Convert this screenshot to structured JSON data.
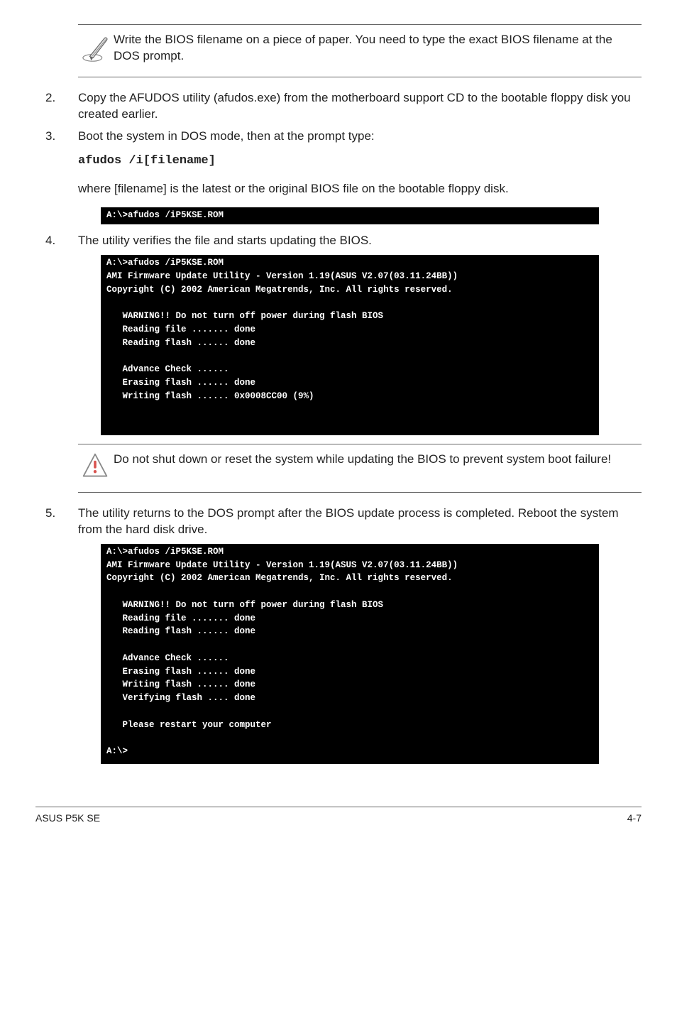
{
  "note1": "Write the BIOS filename on a piece of paper. You need to type the exact BIOS filename at the DOS prompt.",
  "steps": {
    "s2": {
      "num": "2.",
      "text": "Copy the AFUDOS utility (afudos.exe) from the motherboard support CD to the bootable floppy disk you created earlier."
    },
    "s3": {
      "num": "3.",
      "text": "Boot the system in DOS mode, then at the prompt type:",
      "cmd": "afudos /i[filename]"
    },
    "s3_after": "where [filename] is the latest or the original BIOS file on the bootable floppy disk.",
    "s4": {
      "num": "4.",
      "text": "The utility verifies the file and starts updating the BIOS."
    },
    "s5": {
      "num": "5.",
      "text": "The utility returns to the DOS prompt after the BIOS update process is completed. Reboot the system from the hard disk drive."
    }
  },
  "console1": "A:\\>afudos /iP5KSE.ROM",
  "console2": "A:\\>afudos /iP5KSE.ROM\nAMI Firmware Update Utility - Version 1.19(ASUS V2.07(03.11.24BB))\nCopyright (C) 2002 American Megatrends, Inc. All rights reserved.\n\n   WARNING!! Do not turn off power during flash BIOS\n   Reading file ....... done\n   Reading flash ...... done\n\n   Advance Check ......\n   Erasing flash ...... done\n   Writing flash ...... 0x0008CC00 (9%)\n\n\n",
  "warn1": "Do not shut down or reset the system while updating the BIOS to prevent system boot failure!",
  "console3": "A:\\>afudos /iP5KSE.ROM\nAMI Firmware Update Utility - Version 1.19(ASUS V2.07(03.11.24BB))\nCopyright (C) 2002 American Megatrends, Inc. All rights reserved.\n\n   WARNING!! Do not turn off power during flash BIOS\n   Reading file ....... done\n   Reading flash ...... done\n\n   Advance Check ......\n   Erasing flash ...... done\n   Writing flash ...... done\n   Verifying flash .... done\n\n   Please restart your computer\n\nA:\\>",
  "footer": {
    "left": "ASUS P5K SE",
    "right": "4-7"
  }
}
